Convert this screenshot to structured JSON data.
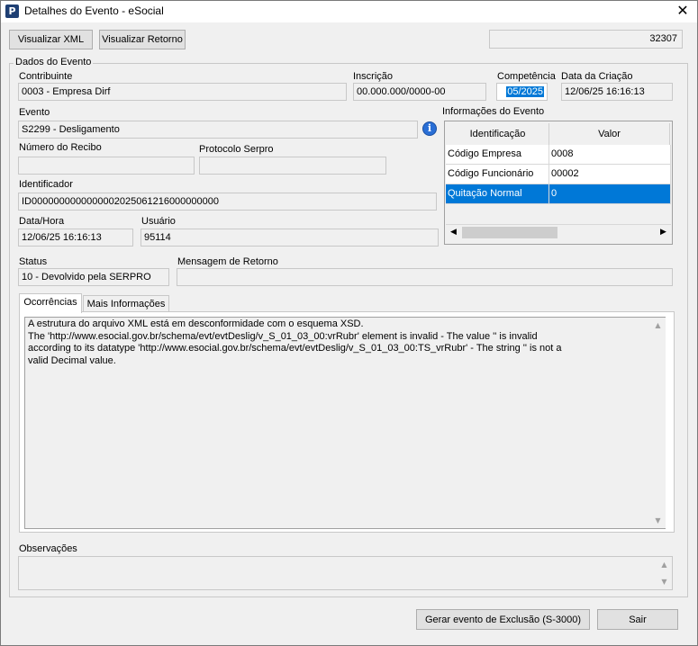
{
  "window": {
    "title": "Detalhes do Evento - eSocial",
    "close_glyph": "✕",
    "app_icon": "P"
  },
  "toolbar": {
    "view_xml": "Visualizar XML",
    "view_return": "Visualizar Retorno",
    "event_number": "32307"
  },
  "group": {
    "title": "Dados do Evento"
  },
  "fields": {
    "contribuinte": {
      "label": "Contribuinte",
      "value": "0003 - Empresa Dirf"
    },
    "inscricao": {
      "label": "Inscrição",
      "value": "00.000.000/0000-00"
    },
    "competencia": {
      "label": "Competência",
      "value": "05/2025"
    },
    "data_criacao": {
      "label": "Data da Criação",
      "value": "12/06/25 16:16:13"
    },
    "evento": {
      "label": "Evento",
      "value": "S2299 - Desligamento"
    },
    "numero_recibo": {
      "label": "Número do Recibo",
      "value": ""
    },
    "protocolo": {
      "label": "Protocolo Serpro",
      "value": ""
    },
    "identificador": {
      "label": "Identificador",
      "value": "ID0000000000000002025061216000000000"
    },
    "data_hora": {
      "label": "Data/Hora",
      "value": "12/06/25 16:16:13"
    },
    "usuario": {
      "label": "Usuário",
      "value": "95114"
    },
    "status": {
      "label": "Status",
      "value": "10 - Devolvido pela SERPRO"
    },
    "mensagem_retorno": {
      "label": "Mensagem de Retorno",
      "value": ""
    }
  },
  "info_grid": {
    "title": "Informações do Evento",
    "columns": [
      "Identificação",
      "Valor"
    ],
    "rows": [
      {
        "id": "Código Empresa",
        "value": "0008"
      },
      {
        "id": "Código Funcionário",
        "value": "00002"
      },
      {
        "id": "Quitação Normal",
        "value": "0"
      }
    ],
    "selected_row": 2
  },
  "tabs": [
    {
      "label": "Ocorrências",
      "active": true
    },
    {
      "label": "Mais Informações",
      "active": false
    }
  ],
  "ocorrencias_text": "A estrutura do arquivo XML está em desconformidade com o esquema XSD.\nThe 'http://www.esocial.gov.br/schema/evt/evtDeslig/v_S_01_03_00:vrRubr' element is invalid - The value '' is invalid\naccording to its datatype 'http://www.esocial.gov.br/schema/evt/evtDeslig/v_S_01_03_00:TS_vrRubr' - The string '' is not a\nvalid Decimal value.",
  "observacoes": {
    "label": "Observações",
    "value": ""
  },
  "footer": {
    "gerar_exclusao": "Gerar evento de Exclusão (S-3000)",
    "sair": "Sair"
  },
  "colors": {
    "selection": "#0078d7",
    "background": "#f0f0f0",
    "info_icon": "#2a6fd6"
  }
}
